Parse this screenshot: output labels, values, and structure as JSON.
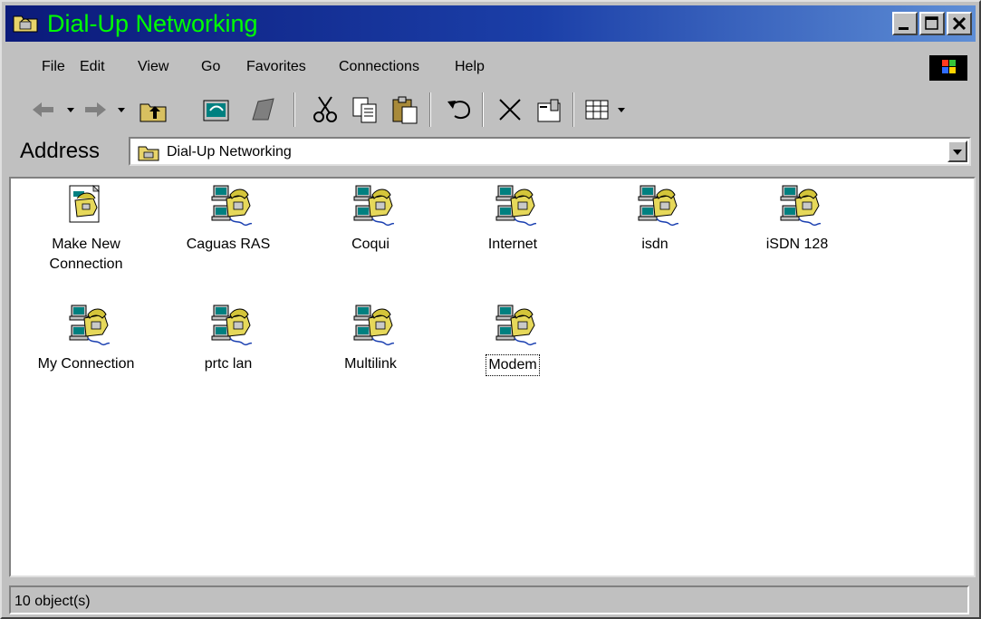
{
  "window": {
    "title": "Dial-Up Networking"
  },
  "menu": {
    "items": [
      "File",
      "Edit",
      "View",
      "Go",
      "Favorites",
      "Connections",
      "Help"
    ]
  },
  "address": {
    "label": "Address",
    "value": "Dial-Up Networking"
  },
  "items": [
    {
      "label": "Make New Connection",
      "icon": "make-new-connection-icon"
    },
    {
      "label": "Caguas RAS",
      "icon": "dialup-connection-icon"
    },
    {
      "label": "Coqui",
      "icon": "dialup-connection-icon"
    },
    {
      "label": "Internet",
      "icon": "dialup-connection-icon"
    },
    {
      "label": "isdn",
      "icon": "dialup-connection-icon"
    },
    {
      "label": "iSDN 128",
      "icon": "dialup-connection-icon"
    },
    {
      "label": "My Connection",
      "icon": "dialup-connection-icon"
    },
    {
      "label": "prtc lan",
      "icon": "dialup-connection-icon"
    },
    {
      "label": "Multilink",
      "icon": "dialup-connection-icon"
    },
    {
      "label": "Modem",
      "icon": "dialup-connection-icon",
      "focused": true
    }
  ],
  "status": {
    "text": "10 object(s)"
  },
  "colors": {
    "title_text": "#00ff00",
    "title_bar_start": "#0b1a7a",
    "title_bar_end": "#5e8ed6",
    "chrome": "#c0c0c0"
  }
}
